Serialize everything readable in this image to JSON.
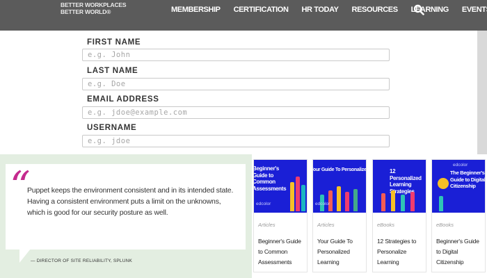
{
  "header": {
    "tagline_line1": "BETTER WORKPLACES",
    "tagline_line2": "BETTER WORLD®",
    "nav": [
      "MEMBERSHIP",
      "CERTIFICATION",
      "HR TODAY",
      "RESOURCES",
      "LEARNING",
      "EVENTS"
    ],
    "search_icon": "search-icon"
  },
  "form": {
    "first_name": {
      "label": "FIRST NAME",
      "placeholder": "e.g. John"
    },
    "last_name": {
      "label": "LAST NAME",
      "placeholder": "e.g. Doe"
    },
    "email": {
      "label": "EMAIL ADDRESS",
      "placeholder": "e.g. jdoe@example.com"
    },
    "username": {
      "label": "USERNAME",
      "placeholder": "e.g. jdoe"
    }
  },
  "testimonial": {
    "quote_mark": "“",
    "text": "Puppet keeps the environment consistent and in its intended state. Having a consistent environment puts a limit on the unknowns, which is good for our security posture as well.",
    "attribution": "— DIRECTOR OF SITE RELIABILITY, SPLUNK"
  },
  "cards": [
    {
      "image_title": "Beginner's Guide to Common Assessments",
      "image_brand": "edcolor",
      "category": "Articles",
      "title": "Beginner's Guide to Common Assessments"
    },
    {
      "image_title": "Your Guide To Personalized Learn",
      "image_brand": "edcolor",
      "category": "Articles",
      "title": "Your Guide To Personalized Learning"
    },
    {
      "image_title": "12 Personalized Learning Strategies",
      "image_brand": "",
      "category": "eBooks",
      "title": "12 Strategies to Personalize Learning"
    },
    {
      "image_title": "The Beginner's Guide to Digital Citizenship",
      "image_brand": "edcolor",
      "category": "eBooks",
      "title": "Beginner's Guide to Digital Citizenship"
    }
  ],
  "colors": {
    "header_bg": "#5b5b5b",
    "quote_accent": "#c52a8e",
    "card_image_bg": "#1a1fd6",
    "testimonial_bg": "#e3eee1"
  }
}
